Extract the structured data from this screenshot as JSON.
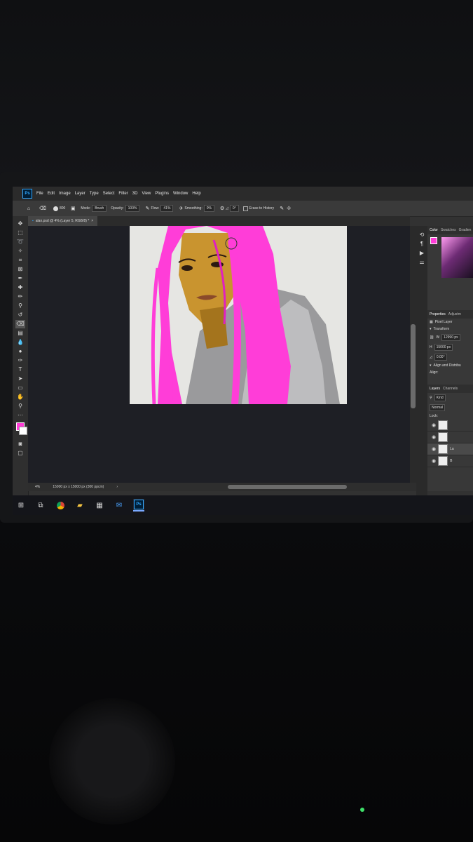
{
  "app": {
    "logo_label": "Ps",
    "accent_color": "#31a8ff",
    "foreground_color": "#ff3dd8",
    "background_color": "#ffffff"
  },
  "menu": [
    "File",
    "Edit",
    "Image",
    "Layer",
    "Type",
    "Select",
    "Filter",
    "3D",
    "View",
    "Plugins",
    "Window",
    "Help"
  ],
  "options_bar": {
    "brush_size": "800",
    "mode_label": "Mode:",
    "mode_value": "Brush",
    "opacity_label": "Opacity:",
    "opacity_value": "100%",
    "flow_label": "Flow:",
    "flow_value": "41%",
    "smoothing_label": "Smoothing:",
    "smoothing_value": "0%",
    "angle_value": "0°",
    "erase_history_label": "Erase to History"
  },
  "document": {
    "tab_title": "alan.psd @ 4% (Layer 5, RGB/8) *",
    "close_icon": "close-icon"
  },
  "status": {
    "zoom": "4%",
    "doc_size": "15000 px x 15000 px (300 ppcm)"
  },
  "panels": {
    "color_tabs": [
      "Color",
      "Swatches",
      "Gradien"
    ],
    "properties_tabs": [
      "Properties",
      "Adjustm"
    ],
    "properties_kind": "Pixel Layer",
    "transform_label": "Transform",
    "w_label": "W",
    "w_value": "12990 px",
    "h_label": "H",
    "h_value": "15000 px",
    "angle_value": "0.00°",
    "align_label": "Align and Distribu",
    "align_sub": "Align:",
    "layers_tabs": [
      "Layers",
      "Channels"
    ],
    "kind_filter": "Kind",
    "blend_mode": "Normal",
    "lock_label": "Lock:",
    "layer_names": [
      "",
      "",
      "La",
      "B"
    ]
  },
  "taskbar": {
    "items": [
      "windows-start-icon",
      "task-view-icon",
      "chrome-icon",
      "file-explorer-icon",
      "store-icon",
      "mail-icon",
      "photoshop-icon"
    ]
  }
}
